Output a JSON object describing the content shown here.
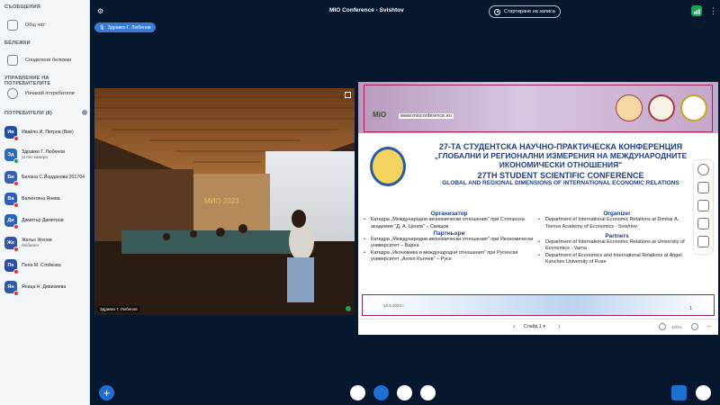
{
  "sidebar": {
    "messages_title": "СЪОБЩЕНИЯ",
    "public_chat": "Общ чат",
    "notes_title": "БЕЛЕЖКИ",
    "shared_notes": "Споделени бележки",
    "management_title": "УПРАВЛЕНИЕ НА ПОТРЕБИТЕЛИТЕ",
    "remove_users": "Изчакай потребители",
    "users_title": "ПОТРЕБИТЕЛИ (8)",
    "users": [
      {
        "initials": "Ив",
        "name": "Ивайло И. Петров (Вие)",
        "status": "",
        "color": "#1f4ea3",
        "badge": "red"
      },
      {
        "initials": "Зд",
        "name": "Здравко Г. Любенов",
        "status": "(а mic-камера",
        "color": "#2a6bbf",
        "badge": "green"
      },
      {
        "initials": "Би",
        "name": "Билана С.Йорданова 201704",
        "status": "",
        "color": "#3a5fb0",
        "badge": "red"
      },
      {
        "initials": "Ва",
        "name": "Валентина Янева",
        "status": "",
        "color": "#2f5fb8",
        "badge": "red"
      },
      {
        "initials": "Ди",
        "name": "Димитър Димитров",
        "status": "",
        "color": "#2a63b5",
        "badge": "red"
      },
      {
        "initials": "Же",
        "name": "Жельо Желев",
        "status": "Мобилен",
        "color": "#3456a8",
        "badge": "red"
      },
      {
        "initials": "Пе",
        "name": "Пепа М. Стойкова",
        "status": "",
        "color": "#2b4fa0",
        "badge": "red"
      },
      {
        "initials": "Ян",
        "name": "Яница Н. Дивизиева",
        "status": "",
        "color": "#2e5aa6",
        "badge": "red"
      }
    ]
  },
  "topbar": {
    "title": "MIO Conference - Svishtov",
    "record_label": "Стартиране на записа",
    "talking": "Здравко Г. Любенов"
  },
  "webcam": {
    "name": "Здравко Г. Любенов"
  },
  "slide": {
    "website": "www.mioconference.eu",
    "bg_title_1": "27-ТА СТУДЕНТСКА НАУЧНО-ПРАКТИЧЕСКА КОНФЕРЕНЦИЯ",
    "bg_title_2": "„ГЛОБАЛНИ И РЕГИОНАЛНИ ИЗМЕРЕНИЯ НА МЕЖДУНАРОДНИТЕ",
    "bg_title_3": "ИКОНОМИЧЕСКИ ОТНОШЕНИЯ\"",
    "en_title_1": "27TH STUDENT SCIENTIFIC CONFERENCE",
    "en_title_2": "GLOBAL AND REGIONAL DIMENSIONS OF INTERNATIONAL ECONOMIC RELATIONS",
    "bg_organizer_h": "Организатор",
    "bg_organizer": "Катедра „Международни икономически отношения\" при Стопанска академия \"Д. А. Ценов\" – Свищов",
    "bg_partners_h": "Партньори",
    "bg_partner_1": "Катедра „Международни икономически отношения\" при Икономически университет – Варна",
    "bg_partner_2": "Катедра „Икономика и международни отношения\" при Русенски университет „Ангел Кънчев\" – Русе",
    "en_organizer_h": "Organizer",
    "en_organizer": "Department of International Economic Relations at Dimitar A. Tsenov Academy of Economics - Svishtov",
    "en_partners_h": "Partners",
    "en_partner_1": "Department of International Economic Relations at University of Economics - Varna",
    "en_partner_2": "Department of Economics and International Relations at Angel Kanchev University of Ruse",
    "date": "13.5.2023 г.",
    "page": "1"
  },
  "pres_bar": {
    "slide_label": "Слайд 1",
    "zoom": "100%"
  }
}
